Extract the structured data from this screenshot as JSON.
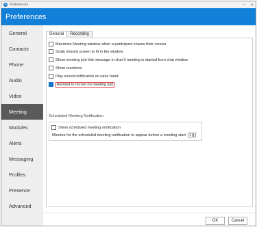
{
  "window": {
    "title": "Preferences",
    "app_icon_letter": "G"
  },
  "header": {
    "title": "Preferences"
  },
  "sidebar": {
    "items": [
      {
        "label": "General"
      },
      {
        "label": "Contacts"
      },
      {
        "label": "Phone"
      },
      {
        "label": "Audio"
      },
      {
        "label": "Video"
      },
      {
        "label": "Meeting",
        "active": true
      },
      {
        "label": "Modules"
      },
      {
        "label": "Alerts"
      },
      {
        "label": "Messaging"
      },
      {
        "label": "Profiles"
      },
      {
        "label": "Presence"
      },
      {
        "label": "Advanced"
      }
    ]
  },
  "tabs": [
    {
      "label": "General",
      "active": true
    },
    {
      "label": "Recording"
    }
  ],
  "options": [
    {
      "label": "Maximize Meeting window when a participant shares their screen",
      "checked": false
    },
    {
      "label": "Scale shared screen to fit in the window",
      "checked": false
    },
    {
      "label": "Show meeting join link message in chat if meeting is started from chat window",
      "checked": false
    },
    {
      "label": "Show reactions",
      "checked": false
    },
    {
      "label": "Play sound notification on raise hand",
      "checked": false
    },
    {
      "label": "Remind to record on meeting join",
      "checked": true
    }
  ],
  "scheduled": {
    "section_title": "Scheduled Meeting Notification",
    "show_label": "Show scheduled meeting notification",
    "show_checked": false,
    "minutes_label": "Minutes for the scheduled meeting notification to appear before a meeting start",
    "minutes_value": "1"
  },
  "footer": {
    "ok_label": "OK",
    "cancel_label": "Cancel"
  }
}
